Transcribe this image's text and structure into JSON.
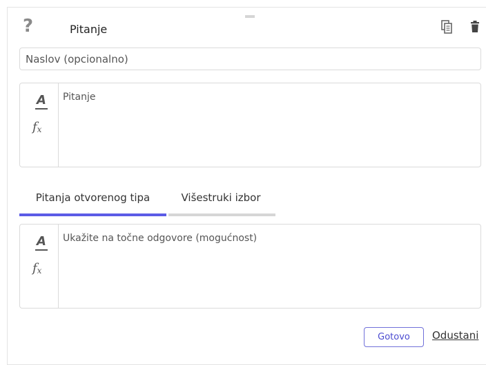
{
  "header": {
    "help_icon": "question-mark-icon",
    "title": "Pitanje",
    "copy_icon": "copy-icon",
    "delete_icon": "trash-icon"
  },
  "caption": {
    "placeholder": "Naslov (opcionalno)",
    "value": ""
  },
  "question_editor": {
    "format_icon": "text-format-icon",
    "formula_icon": "formula-icon",
    "placeholder": "Pitanje"
  },
  "tabs": [
    {
      "label": "Pitanja otvorenog tipa",
      "active": true
    },
    {
      "label": "Višestruki izbor",
      "active": false
    }
  ],
  "answer_editor": {
    "format_icon": "text-format-icon",
    "formula_icon": "formula-icon",
    "placeholder": "Ukažite na točne odgovore (mogućnost)"
  },
  "footer": {
    "done_label": "Gotovo",
    "cancel_label": "Odustani"
  },
  "colors": {
    "accent": "#5b5be6",
    "inactive_tab_bar": "#d6d6d6",
    "border": "#dadada",
    "icon_gray": "#8a8a8a"
  }
}
